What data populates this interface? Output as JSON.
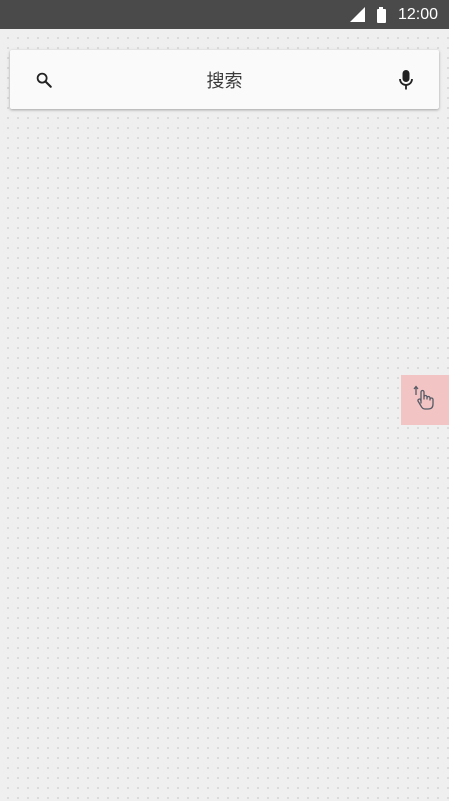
{
  "status_bar": {
    "time": "12:00",
    "icons": [
      "cell-signal-icon",
      "battery-icon"
    ]
  },
  "search": {
    "placeholder": "搜索",
    "left_icon": "search-icon",
    "right_icon": "microphone-icon"
  },
  "floating_tool": {
    "icon": "touch-gesture-icon"
  },
  "colors": {
    "status_bar_bg": "#4a4a4a",
    "background": "#efefef",
    "search_bar_bg": "#fafafa",
    "floating_tool_bg": "#f3c4c4"
  }
}
